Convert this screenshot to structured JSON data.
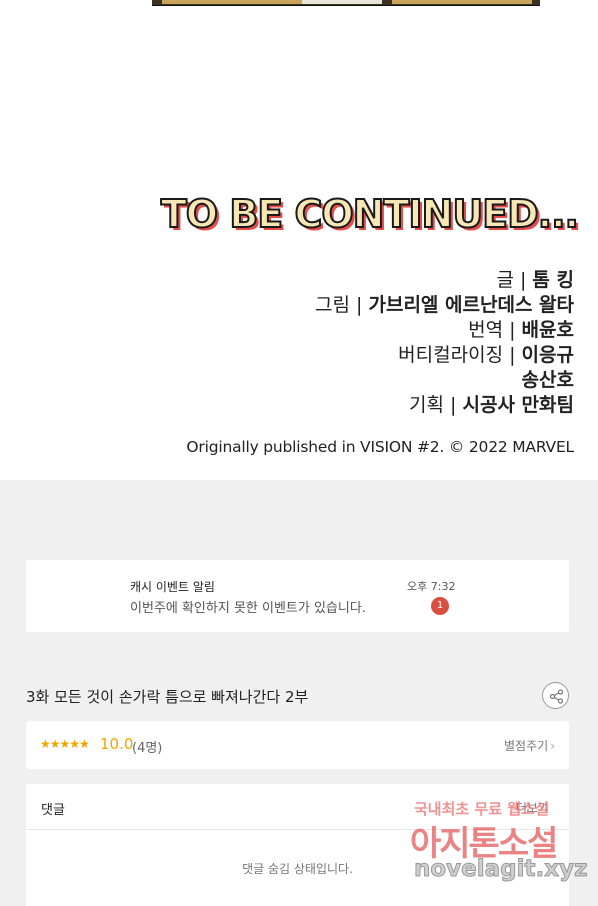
{
  "comic": {
    "to_be_continued": "TO BE CONTINUED...",
    "credits": [
      {
        "role": "글 | ",
        "name": "톰 킹"
      },
      {
        "role": "그림 | ",
        "name": "가브리엘 에르난데스 왈타"
      },
      {
        "role": "번역 | ",
        "name": "배윤호"
      },
      {
        "role": "버티컬라이징 | ",
        "name": "이응규"
      },
      {
        "role": "",
        "name": "송산호"
      },
      {
        "role": "기획 | ",
        "name": "시공사 만화팀"
      }
    ],
    "published": "Originally published in VISION #2. © 2022 MARVEL"
  },
  "notice": {
    "title": "캐시 이벤트 알림",
    "message": "이번주에 확인하지 못한 이벤트가 있습니다.",
    "time": "오후 7:32",
    "badge": "1"
  },
  "episode": {
    "title": "3화 모든 것이 손가락 틈으로 빠져나간다 2부",
    "share_icon": "share-icon"
  },
  "rating": {
    "stars": "★★★★★",
    "score": "10.0",
    "count": "(4명)",
    "rate_link": "별점주기",
    "chevron": "›"
  },
  "comments": {
    "label": "댓글",
    "more": "더보기",
    "hidden_message": "댓글 숨김 상태입니다."
  },
  "watermark": {
    "line1": "국내최초 무료 웹소설",
    "line2": "아지톤소설",
    "line3": "novelagit.xyz"
  },
  "colors": {
    "accent_orange": "#f0a500",
    "badge_red": "#d94f3d",
    "background": "#f0f0f0"
  }
}
